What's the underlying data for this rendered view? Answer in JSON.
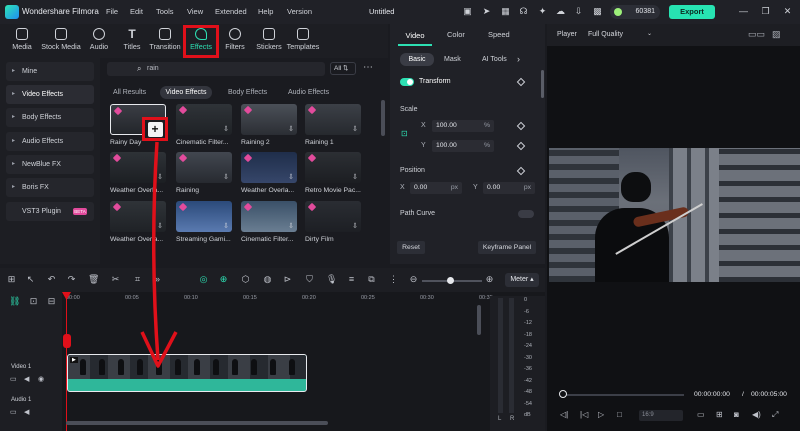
{
  "app": {
    "name": "Wondershare Filmora",
    "project_title": "Untitled"
  },
  "menu": [
    "File",
    "Edit",
    "Tools",
    "View",
    "Extended",
    "Help",
    "Version"
  ],
  "header": {
    "credits": "60381",
    "export_label": "Export"
  },
  "media_tabs": [
    {
      "label": "Media",
      "icon": "media-icon"
    },
    {
      "label": "Stock Media",
      "icon": "stock-media-icon"
    },
    {
      "label": "Audio",
      "icon": "audio-icon"
    },
    {
      "label": "Titles",
      "icon": "titles-icon"
    },
    {
      "label": "Transition",
      "icon": "transition-icon"
    },
    {
      "label": "Effects",
      "icon": "effects-icon",
      "active": true
    },
    {
      "label": "Filters",
      "icon": "filters-icon"
    },
    {
      "label": "Stickers",
      "icon": "stickers-icon"
    },
    {
      "label": "Templates",
      "icon": "templates-icon"
    }
  ],
  "left_nav": [
    {
      "label": "Mine"
    },
    {
      "label": "Video Effects",
      "active": true
    },
    {
      "label": "Body Effects"
    },
    {
      "label": "Audio Effects"
    },
    {
      "label": "NewBlue FX"
    },
    {
      "label": "Boris FX"
    },
    {
      "label": "VST3 Plugin",
      "badge": "BETA"
    }
  ],
  "search": {
    "value": "rain",
    "sort_label": "All"
  },
  "categories": [
    "All Results",
    "Video Effects",
    "Body Effects",
    "Audio Effects"
  ],
  "effects": [
    {
      "label": "Rainy Day"
    },
    {
      "label": "Cinematic Filter..."
    },
    {
      "label": "Raining 2"
    },
    {
      "label": "Raining 1"
    },
    {
      "label": "Weather Overla..."
    },
    {
      "label": "Raining"
    },
    {
      "label": "Weather Overla..."
    },
    {
      "label": "Retro Movie Pac..."
    },
    {
      "label": "Weather Overla..."
    },
    {
      "label": "Streaming Gami..."
    },
    {
      "label": "Cinematic Filter..."
    },
    {
      "label": "Dirty Film"
    }
  ],
  "properties": {
    "tabs": [
      "Video",
      "Color",
      "Speed"
    ],
    "subtabs": [
      "Basic",
      "Mask",
      "AI Tools"
    ],
    "transform_label": "Transform",
    "scale_label": "Scale",
    "scale_x": "100.00",
    "scale_y": "100.00",
    "scale_unit": "%",
    "position_label": "Position",
    "pos_x": "0.00",
    "pos_y": "0.00",
    "pos_unit": "px",
    "axis_x": "X",
    "axis_y": "Y",
    "path_curve_label": "Path Curve",
    "reset_label": "Reset",
    "keyframe_label": "Keyframe Panel"
  },
  "player": {
    "label": "Player",
    "quality": "Full Quality",
    "current_time": "00:00:00:00",
    "separator": "/",
    "total_time": "00:00:05:00"
  },
  "timeline": {
    "meter_label": "Meter",
    "ruler": [
      "00:00",
      "00:05",
      "00:10",
      "00:15",
      "00:20",
      "00:25",
      "00:30",
      "00:35"
    ],
    "tracks": [
      {
        "label": "Video 1"
      },
      {
        "label": "Audio 1"
      }
    ],
    "meter_scale": [
      "0",
      "-6",
      "-12",
      "-18",
      "-24",
      "-30",
      "-36",
      "-42",
      "-48",
      "-54",
      "dB"
    ],
    "meter_lr": [
      "L",
      "R"
    ]
  },
  "colors": {
    "accent": "#2de0b3",
    "highlight": "#e0101a",
    "badge": "#e24b9c"
  }
}
